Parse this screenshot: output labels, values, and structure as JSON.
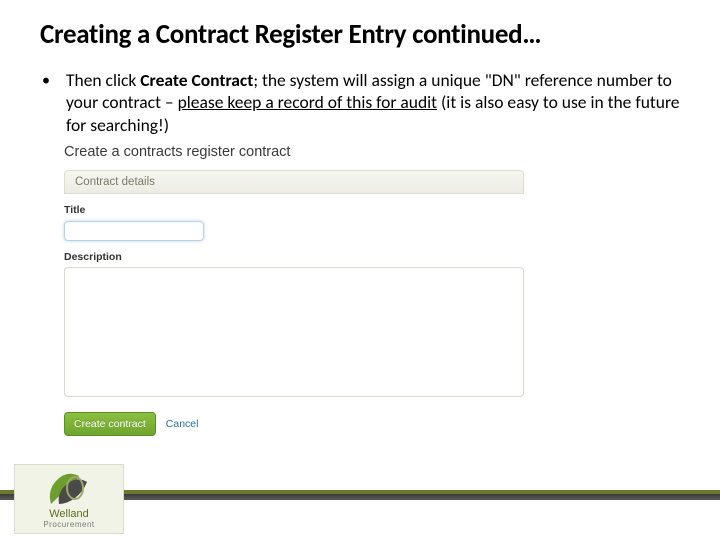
{
  "title": "Creating a Contract Register Entry continued…",
  "bullet": {
    "pre": "Then click ",
    "bold": "Create Contract",
    "mid": "; the system will assign a unique \"DN\" reference number to your contract – ",
    "underline": "please keep a record of this for audit",
    "post": " (it is also easy to use in the future for searching!)"
  },
  "form": {
    "heading": "Create a contracts register contract",
    "panel": "Contract details",
    "titleLabel": "Title",
    "titleValue": " ",
    "descLabel": "Description",
    "descValue": "",
    "createBtn": "Create contract",
    "cancel": "Cancel"
  },
  "logo": {
    "line1": "Welland",
    "line2": "Procurement"
  }
}
